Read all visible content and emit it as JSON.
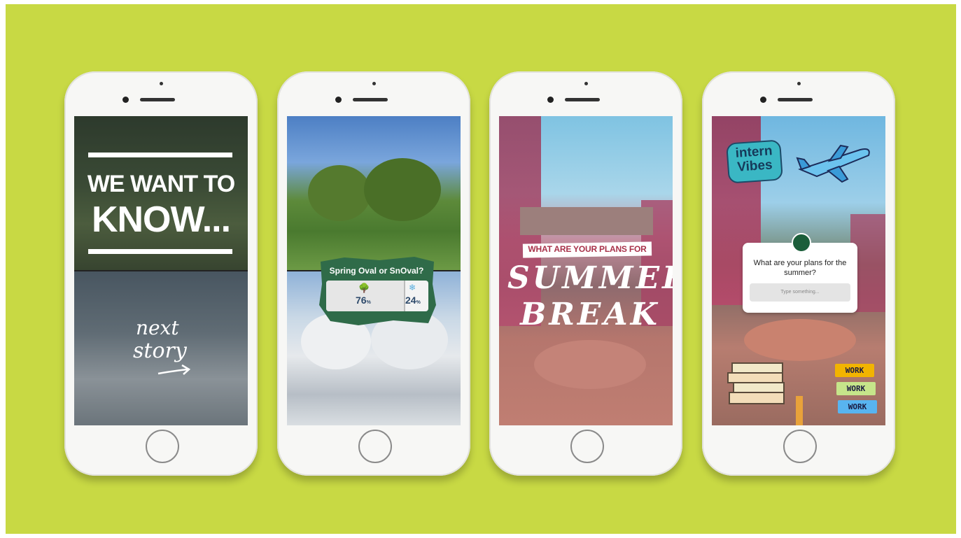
{
  "story1": {
    "headline_line1": "WE WANT TO",
    "headline_line2": "KNOW...",
    "script_line1": "next",
    "script_line2": "story"
  },
  "story2": {
    "poll_question": "Spring Oval or SnOval?",
    "option_a_icon": "tree-icon",
    "option_a_value": "76",
    "option_b_icon": "snowflake-icon",
    "option_b_value": "24",
    "percent_sign": "%",
    "option_a_fraction": 0.76,
    "sticker_color": "#2f6b49"
  },
  "story3": {
    "banner": "WHAT ARE YOUR PLANS FOR",
    "title_line1": "SUMMER",
    "title_line2": "BREAK",
    "banner_color": "#a8324a"
  },
  "story4": {
    "sticker_intern_line1": "intern",
    "sticker_intern_line2": "Vibes",
    "question": "What are your plans for the summer?",
    "input_placeholder": "Type something...",
    "tags": [
      "WORK",
      "WORK",
      "WORK"
    ],
    "tag_colors": [
      "#f2b400",
      "#c6e58a",
      "#58b4f0"
    ]
  }
}
